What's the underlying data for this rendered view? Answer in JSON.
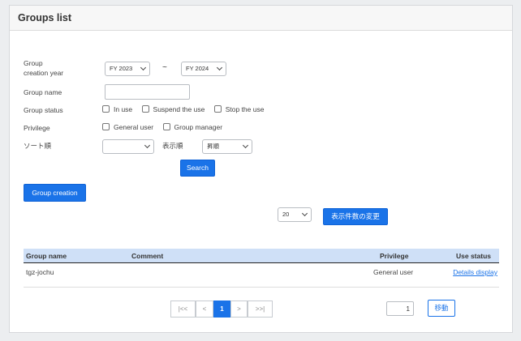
{
  "panel": {
    "title": "Groups list"
  },
  "filters": {
    "creation_year_label": "Group\ncreation year",
    "year_from": "FY 2023",
    "year_separator": "~",
    "year_to": "FY 2024",
    "group_name_label": "Group name",
    "group_name_value": "",
    "status_label": "Group status",
    "status_options": [
      "In use",
      "Suspend the use",
      "Stop the use"
    ],
    "privilege_label": "Privilege",
    "privilege_options": [
      "General user",
      "Group manager"
    ],
    "sort_label": "ソート順",
    "sort_value": "",
    "order_label": "表示順",
    "order_value": "昇順",
    "search_button": "Search"
  },
  "actions": {
    "group_creation_button": "Group creation",
    "page_size_value": "20",
    "page_size_button": "表示件数の変更"
  },
  "table": {
    "headers": {
      "name": "Group name",
      "comment": "Comment",
      "privilege": "Privilege",
      "status": "Use status"
    },
    "rows": [
      {
        "name": "tgz-jochu",
        "comment": "",
        "privilege": "General user",
        "status": "Details display"
      }
    ]
  },
  "pagination": {
    "first": "|<<",
    "prev": "<",
    "current": "1",
    "next": ">",
    "last": ">>|",
    "page_input": "1",
    "go_button": "移動"
  },
  "colors": {
    "accent": "#1a73e8",
    "table_header_bg": "#cfe0f7"
  }
}
